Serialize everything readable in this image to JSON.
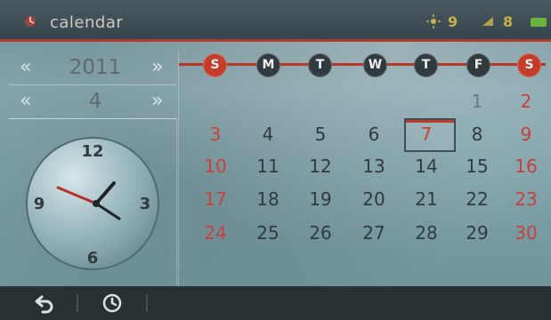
{
  "status_bar": {
    "title": "calendar",
    "indicator_1_value": "9",
    "indicator_2_value": "8"
  },
  "controls": {
    "year_value": "2011",
    "month_value": "4",
    "prev_symbol": "«",
    "next_symbol": "»"
  },
  "calendar": {
    "weekdays": [
      "S",
      "M",
      "T",
      "W",
      "T",
      "F",
      "S"
    ],
    "weeks": [
      [
        "",
        "",
        "",
        "",
        "",
        "1",
        "2"
      ],
      [
        "3",
        "4",
        "5",
        "6",
        "7",
        "8",
        "9"
      ],
      [
        "10",
        "11",
        "12",
        "13",
        "14",
        "15",
        "16"
      ],
      [
        "17",
        "18",
        "19",
        "20",
        "21",
        "22",
        "23"
      ],
      [
        "24",
        "25",
        "26",
        "27",
        "28",
        "29",
        "30"
      ]
    ],
    "selected_day": "7"
  },
  "clock": {
    "numbers": [
      "12",
      "3",
      "6",
      "9"
    ]
  },
  "colors": {
    "accent_red": "#c33d2a",
    "status_yellow": "#c7b24b",
    "battery_green": "#6bb33e"
  }
}
